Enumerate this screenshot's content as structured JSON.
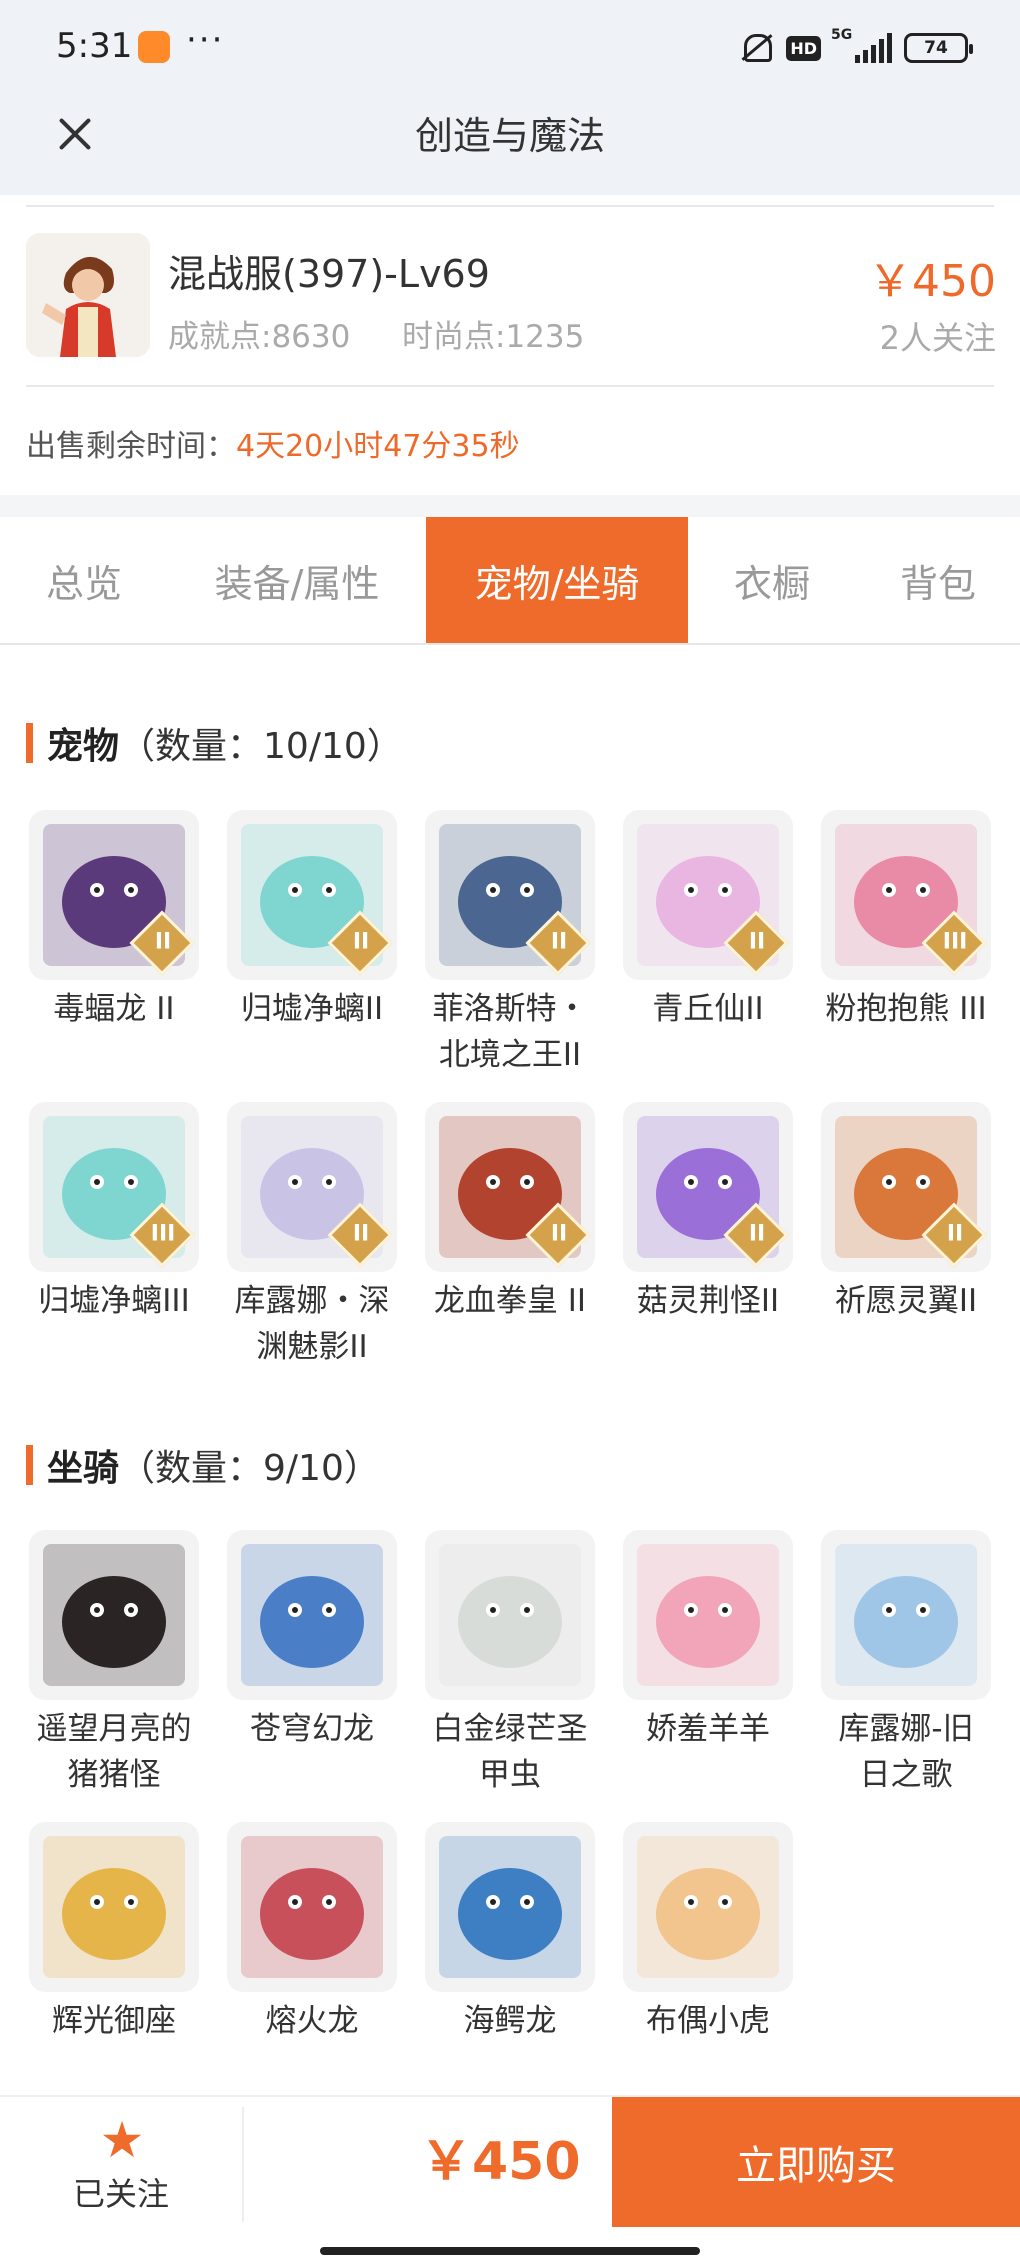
{
  "status_bar": {
    "time": "5:31",
    "dots": "···",
    "hd": "HD",
    "network": "5G",
    "battery": "74"
  },
  "header": {
    "title": "创造与魔法",
    "close_icon": "close-icon"
  },
  "account": {
    "name": "混战服(397)-Lv69",
    "achievement": "成就点:8630",
    "fashion": "时尚点:1235",
    "price": "￥450",
    "watchers": "2人关注",
    "remain_label": "出售剩余时间：",
    "remain_value": "4天20小时47分35秒"
  },
  "tabs": [
    {
      "label": "总览",
      "active": false
    },
    {
      "label": "装备/属性",
      "active": false
    },
    {
      "label": "宠物/坐骑",
      "active": true
    },
    {
      "label": "衣橱",
      "active": false
    },
    {
      "label": "背包",
      "active": false
    }
  ],
  "pets": {
    "title": "宠物",
    "count": "（数量：10/10）",
    "items": [
      {
        "line1": "毒蝠龙 II",
        "line2": "",
        "rank": "II",
        "color": "#5a3a7a"
      },
      {
        "line1": "归墟净螭II",
        "line2": "",
        "rank": "II",
        "color": "#7fd6d0"
      },
      {
        "line1": "菲洛斯特・",
        "line2": "北境之王II",
        "rank": "II",
        "color": "#4b6690"
      },
      {
        "line1": "青丘仙II",
        "line2": "",
        "rank": "II",
        "color": "#e8b6e0"
      },
      {
        "line1": "粉抱抱熊 III",
        "line2": "",
        "rank": "III",
        "color": "#e98aa6"
      },
      {
        "line1": "归墟净螭III",
        "line2": "",
        "rank": "III",
        "color": "#7fd6d0"
      },
      {
        "line1": "库露娜・深",
        "line2": "渊魅影II",
        "rank": "II",
        "color": "#c9c4e6"
      },
      {
        "line1": "龙血拳皇 II",
        "line2": "",
        "rank": "II",
        "color": "#b2442f"
      },
      {
        "line1": "菇灵荆怪II",
        "line2": "",
        "rank": "II",
        "color": "#9a6fd8"
      },
      {
        "line1": "祈愿灵翼II",
        "line2": "",
        "rank": "II",
        "color": "#d9783a"
      }
    ]
  },
  "mounts": {
    "title": "坐骑",
    "count": "（数量：9/10）",
    "items": [
      {
        "line1": "遥望月亮的",
        "line2": "猪猪怪",
        "color": "#2b2424"
      },
      {
        "line1": "苍穹幻龙",
        "line2": "",
        "color": "#4a7fc8"
      },
      {
        "line1": "白金绿芒圣",
        "line2": "甲虫",
        "color": "#d8dcd8"
      },
      {
        "line1": "娇羞羊羊",
        "line2": "",
        "color": "#f2a4b8"
      },
      {
        "line1": "库露娜-旧",
        "line2": "日之歌",
        "color": "#9fc6e6"
      },
      {
        "line1": "辉光御座",
        "line2": "",
        "color": "#e6b54a"
      },
      {
        "line1": "熔火龙",
        "line2": "",
        "color": "#c8505a"
      },
      {
        "line1": "海鳄龙",
        "line2": "",
        "color": "#3e7fc4"
      },
      {
        "line1": "布偶小虎",
        "line2": "",
        "color": "#f2c48e"
      }
    ]
  },
  "bottom": {
    "follow_label": "已关注",
    "price": "￥450",
    "buy_label": "立即购买",
    "star_icon": "star-icon"
  },
  "colors": {
    "accent": "#ef6b2c",
    "header_bg": "#eff3f7",
    "muted_text": "#aaaaaa"
  }
}
